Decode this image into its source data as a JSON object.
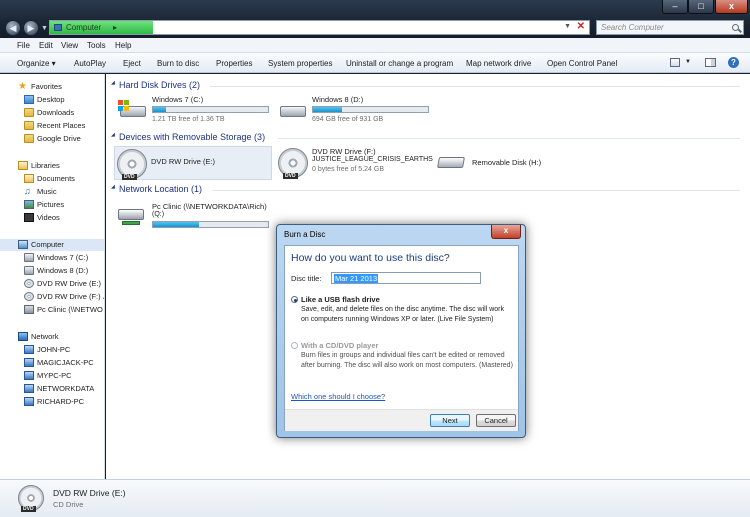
{
  "window": {
    "address_crumb": "Computer",
    "address_sep": "▸",
    "search_placeholder": "Search Computer",
    "minimize_glyph": "–",
    "maximize_glyph": "□",
    "close_glyph": "x"
  },
  "menubar": {
    "items": [
      "File",
      "Edit",
      "View",
      "Tools",
      "Help"
    ]
  },
  "commandbar": {
    "items": [
      "Organize ▾",
      "AutoPlay",
      "Eject",
      "Burn to disc",
      "Properties",
      "System properties",
      "Uninstall or change a program",
      "Map network drive",
      "Open Control Panel"
    ],
    "help": "?"
  },
  "sidebar": {
    "favorites": {
      "header": "Favorites",
      "items": [
        "Desktop",
        "Downloads",
        "Recent Places",
        "Google Drive"
      ]
    },
    "libraries": {
      "header": "Libraries",
      "items": [
        "Documents",
        "Music",
        "Pictures",
        "Videos"
      ]
    },
    "computer": {
      "header": "Computer",
      "items": [
        "Windows 7 (C:)",
        "Windows 8 (D:)",
        "DVD RW Drive (E:)",
        "DVD RW Drive (F:) JU",
        "Pc Clinic (\\\\NETWO"
      ]
    },
    "network": {
      "header": "Network",
      "items": [
        "JOHN-PC",
        "MAGICJACK-PC",
        "MYPC-PC",
        "NETWORKDATA",
        "RICHARD-PC"
      ]
    }
  },
  "content": {
    "groups": {
      "hdd": "Hard Disk Drives (2)",
      "removable": "Devices with Removable Storage (3)",
      "network": "Network Location (1)"
    },
    "drives": {
      "c": {
        "name": "Windows 7 (C:)",
        "free": "1.21 TB free of 1.36 TB",
        "used_fraction": 0.11
      },
      "d": {
        "name": "Windows 8 (D:)",
        "free": "694 GB free of 931 GB",
        "used_fraction": 0.25
      },
      "e": {
        "name": "DVD RW Drive (E:)",
        "badge": "DVD"
      },
      "f": {
        "name": "DVD RW Drive (F:)",
        "label": "JUSTICE_LEAGUE_CRISIS_EARTHS",
        "free": "0 bytes free of 5.24 GB",
        "badge": "DVD"
      },
      "h": {
        "name": "Removable Disk (H:)"
      },
      "q": {
        "name": "Pc Clinic (\\\\NETWORKDATA\\Rich)",
        "letter": "(Q:)",
        "used_fraction": 0.4
      }
    }
  },
  "details": {
    "name": "DVD RW Drive (E:)",
    "type": "CD Drive",
    "badge": "DVD"
  },
  "dialog": {
    "title": "Burn a Disc",
    "close_glyph": "x",
    "heading": "How do you want to use this disc?",
    "disc_title_label": "Disc title:",
    "disc_title_value": "Mar 21 2013",
    "option1_title": "Like a USB flash drive",
    "option1_desc": "Save, edit, and delete files on the disc anytime. The disc will work on computers running Windows XP or later. (Live File System)",
    "option2_title": "With a CD/DVD player",
    "option2_desc": "Burn files in groups and individual files can't be edited or removed after burning. The disc will also work on most computers. (Mastered)",
    "help_link": "Which one should I choose?",
    "next": "Next",
    "cancel": "Cancel"
  }
}
